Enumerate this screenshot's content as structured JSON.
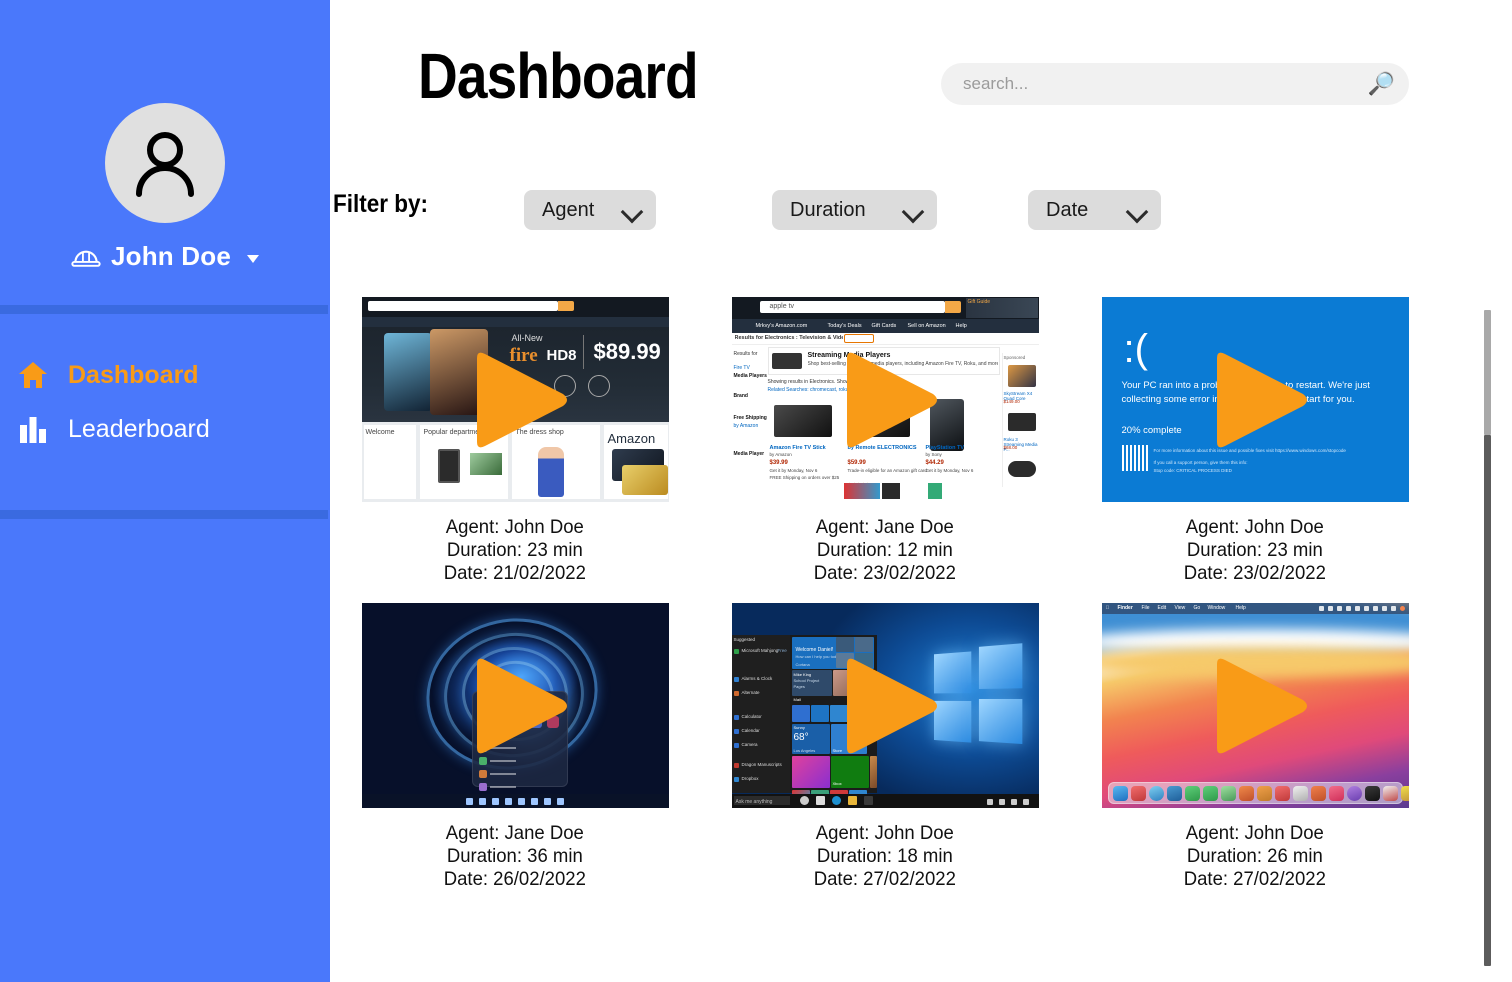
{
  "sidebar": {
    "avatar_icon": "user-avatar-icon",
    "user_badge_icon": "hard-hat-icon",
    "user_name": "John Doe",
    "dropdown_icon": "caret-down-icon",
    "items": [
      {
        "label": "Dashboard",
        "icon": "home-icon",
        "active": true
      },
      {
        "label": "Leaderboard",
        "icon": "bar-chart-icon",
        "active": false
      }
    ],
    "accent_color": "#f99b17",
    "background_color": "#4a78fb",
    "divider_color": "#3a6ae0"
  },
  "header": {
    "title": "Dashboard",
    "search": {
      "placeholder": "search...",
      "value": "",
      "icon": "search-icon"
    }
  },
  "filters": {
    "label": "Filter by:",
    "chips": [
      {
        "label": "Agent",
        "icon": "chevron-down-icon"
      },
      {
        "label": "Duration",
        "icon": "chevron-down-icon"
      },
      {
        "label": "Date",
        "icon": "chevron-down-icon"
      }
    ]
  },
  "videos": [
    {
      "thumbnail": "amazon-fire-hd8-homepage",
      "play_icon": "play-icon",
      "agent_line": "Agent: John Doe",
      "duration_line": "Duration: 23 min",
      "date_line": "Date: 21/02/2022",
      "agent": "John Doe",
      "duration": "23 min",
      "date": "21/02/2022"
    },
    {
      "thumbnail": "amazon-streaming-media-players-search",
      "play_icon": "play-icon",
      "agent_line": "Agent: Jane Doe",
      "duration_line": "Duration: 12 min",
      "date_line": "Date: 23/02/2022",
      "agent": "Jane Doe",
      "duration": "12 min",
      "date": "23/02/2022"
    },
    {
      "thumbnail": "windows-blue-screen-of-death",
      "play_icon": "play-icon",
      "agent_line": "Agent: John Doe",
      "duration_line": "Duration: 23 min",
      "date_line": "Date: 23/02/2022",
      "agent": "John Doe",
      "duration": "23 min",
      "date": "23/02/2022"
    },
    {
      "thumbnail": "windows-11-desktop",
      "play_icon": "play-icon",
      "agent_line": "Agent: Jane Doe",
      "duration_line": "Duration: 36 min",
      "date_line": "Date: 26/02/2022",
      "agent": "Jane Doe",
      "duration": "36 min",
      "date": "26/02/2022"
    },
    {
      "thumbnail": "windows-10-start-menu",
      "play_icon": "play-icon",
      "agent_line": "Agent: John Doe",
      "duration_line": "Duration: 18 min",
      "date_line": "Date: 27/02/2022",
      "agent": "John Doe",
      "duration": "18 min",
      "date": "27/02/2022"
    },
    {
      "thumbnail": "macos-big-sur-desktop",
      "play_icon": "play-icon",
      "agent_line": "Agent: John Doe",
      "duration_line": "Duration: 26 min",
      "date_line": "Date: 27/02/2022",
      "agent": "John Doe",
      "duration": "26 min",
      "date": "27/02/2022"
    }
  ],
  "thumbnail_text": {
    "amazon_fire": {
      "all_new": "All-New",
      "fire": "fire",
      "hd8": "HD8",
      "price": "$89.99",
      "popular_departments": "Popular departments",
      "dress_shop": "The dress shop",
      "amazon": "Amazon"
    },
    "amazon_search": {
      "query": "apple tv",
      "breadcrumb": "Results for Electronics : Television & Video : Streaming Media Players",
      "banner_title": "Streaming Media Players",
      "banner_sub": "Shop best-selling streaming media players, including Amazon Fire TV, Roku, and more.",
      "product_1": "Amazon Fire TV Stick",
      "product_3": "PlayStation TV",
      "sponsored": "Sponsored",
      "gift_guide": "Gift Guide"
    },
    "bsod": {
      "face": ":(",
      "message": "Your PC ran into a problem and needs to restart. We're just collecting some error info, and then we'll restart for you.",
      "progress": "20% complete"
    },
    "macos": {
      "menu": [
        "Finder",
        "File",
        "Edit",
        "View",
        "Go",
        "Window",
        "Help"
      ]
    }
  },
  "scrollbar": {
    "thumb_color": "#a9a9a9",
    "rail_color": "#5c5c5c"
  }
}
